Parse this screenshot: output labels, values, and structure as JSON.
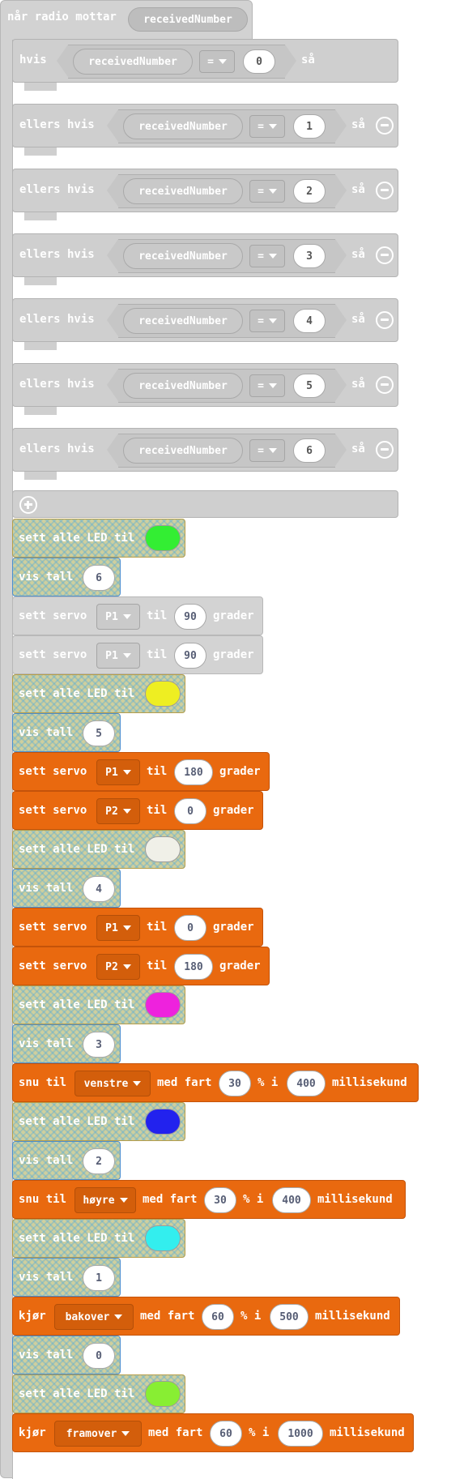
{
  "event": {
    "label": "når radio mottar",
    "param": "receivedNumber"
  },
  "if_chain": {
    "first_keyword": "hvis",
    "elseif_keyword": "ellers hvis",
    "then_keyword": "så",
    "variable": "receivedNumber",
    "operator": "=",
    "values": [
      "0",
      "1",
      "2",
      "3",
      "4",
      "5",
      "6"
    ]
  },
  "led_label": "sett alle LED til",
  "show_label": "vis tall",
  "servo": {
    "label": "sett servo",
    "to": "til",
    "unit": "grader"
  },
  "turn": {
    "label": "snu til",
    "speed": "med fart",
    "pct": "% i",
    "unit": "millisekund"
  },
  "drive": {
    "label": "kjør",
    "speed": "med fart",
    "pct": "% i",
    "unit": "millisekund"
  },
  "blocks": [
    {
      "kind": "led",
      "color": "#33ee33"
    },
    {
      "kind": "show",
      "value": "6"
    },
    {
      "kind": "servo",
      "style": "gray",
      "pin": "P1",
      "deg": "90"
    },
    {
      "kind": "servo",
      "style": "gray",
      "pin": "P1",
      "deg": "90"
    },
    {
      "kind": "led",
      "color": "#eeee22"
    },
    {
      "kind": "show",
      "value": "5"
    },
    {
      "kind": "servo",
      "style": "orange",
      "pin": "P1",
      "deg": "180"
    },
    {
      "kind": "servo",
      "style": "orange",
      "pin": "P2",
      "deg": "0"
    },
    {
      "kind": "led",
      "color": "#f0f0e8"
    },
    {
      "kind": "show",
      "value": "4"
    },
    {
      "kind": "servo",
      "style": "orange",
      "pin": "P1",
      "deg": "0"
    },
    {
      "kind": "servo",
      "style": "orange",
      "pin": "P2",
      "deg": "180"
    },
    {
      "kind": "led",
      "color": "#ee22dd"
    },
    {
      "kind": "show",
      "value": "3"
    },
    {
      "kind": "turn",
      "dir": "venstre",
      "speed": "30",
      "ms": "400"
    },
    {
      "kind": "led",
      "color": "#2222ee"
    },
    {
      "kind": "show",
      "value": "2"
    },
    {
      "kind": "turn",
      "dir": "høyre",
      "speed": "30",
      "ms": "400"
    },
    {
      "kind": "led",
      "color": "#33eeee"
    },
    {
      "kind": "show",
      "value": "1"
    },
    {
      "kind": "drive",
      "dir": "bakover",
      "speed": "60",
      "ms": "500"
    },
    {
      "kind": "show",
      "value": "0"
    },
    {
      "kind": "led",
      "color": "#88ee33"
    },
    {
      "kind": "drive",
      "dir": "framover",
      "speed": "60",
      "ms": "1000"
    }
  ]
}
